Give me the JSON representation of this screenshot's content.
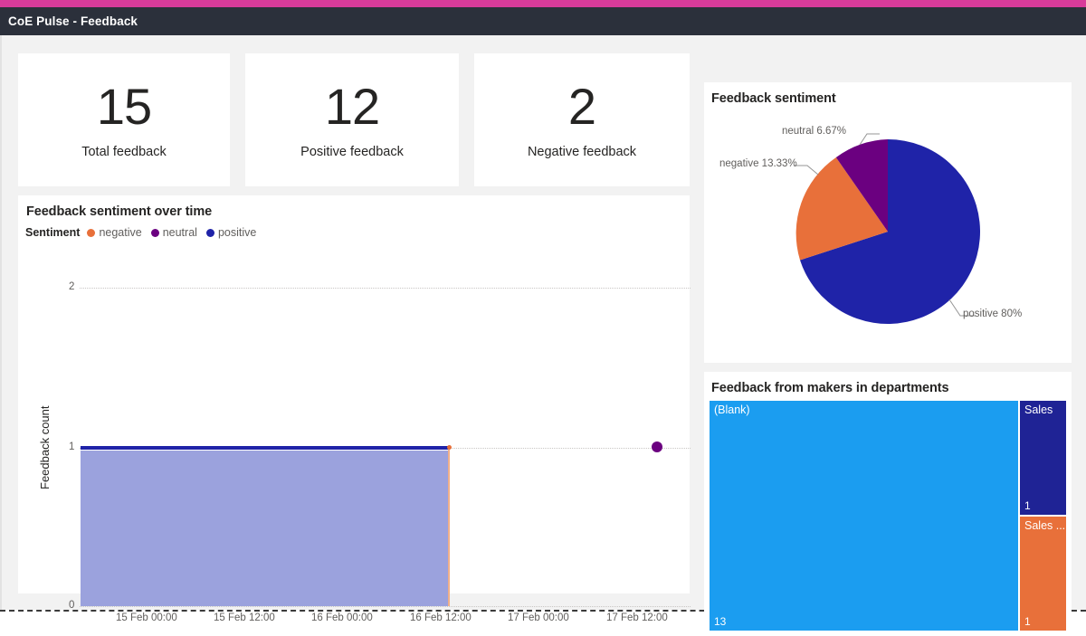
{
  "window": {
    "title": "CoE Pulse - Feedback",
    "accent_color": "#d83b9a",
    "titlebar_color": "#2b303b",
    "canvas_color": "#f2f2f2"
  },
  "kpis": [
    {
      "name": "total-feedback",
      "value": "15",
      "label": "Total feedback"
    },
    {
      "name": "positive-feedback",
      "value": "12",
      "label": "Positive feedback"
    },
    {
      "name": "negative-feedback",
      "value": "2",
      "label": "Negative feedback"
    }
  ],
  "line_visual": {
    "title": "Feedback sentiment over time",
    "legend_caption": "Sentiment",
    "legend": [
      {
        "label": "negative",
        "color": "#e8703a"
      },
      {
        "label": "neutral",
        "color": "#6b0080"
      },
      {
        "label": "positive",
        "color": "#1f23a8"
      }
    ]
  },
  "pie_visual": {
    "title": "Feedback sentiment",
    "labels": [
      {
        "text": "neutral 6.67%",
        "color": "#6b0080"
      },
      {
        "text": "negative 13.33%",
        "color": "#e8703a"
      },
      {
        "text": "positive 80%",
        "color": "#1f23a8"
      }
    ]
  },
  "treemap_visual": {
    "title": "Feedback from makers in departments",
    "nodes": [
      {
        "name": "(Blank)",
        "value": "13",
        "color": "#1b9df0"
      },
      {
        "name": "Sales",
        "value": "1",
        "color": "#1f2395"
      },
      {
        "name": "Sales ...",
        "value": "1",
        "color": "#e8703a"
      }
    ]
  },
  "chart_data": [
    {
      "type": "area",
      "title": "Feedback sentiment over time",
      "xlabel": "",
      "ylabel": "Feedback count",
      "ylim": [
        0,
        2
      ],
      "yticks": [
        "0",
        "1",
        "2"
      ],
      "xticks": [
        "15 Feb 00:00",
        "15 Feb 12:00",
        "16 Feb 00:00",
        "16 Feb 12:00",
        "17 Feb 00:00",
        "17 Feb 12:00"
      ],
      "grid": true,
      "legend_position": "top-left",
      "series": [
        {
          "name": "negative",
          "color": "#e8703a",
          "values": [
            0,
            0,
            0,
            0,
            0,
            0
          ]
        },
        {
          "name": "neutral",
          "color": "#6b0080",
          "values": [
            0,
            0,
            0,
            0,
            0,
            1
          ]
        },
        {
          "name": "positive",
          "color": "#1f23a8",
          "values": [
            1,
            1,
            1,
            1,
            0,
            0
          ]
        }
      ]
    },
    {
      "type": "pie",
      "title": "Feedback sentiment",
      "categories": [
        "positive",
        "negative",
        "neutral"
      ],
      "values": [
        80,
        13.33,
        6.67
      ],
      "value_labels": [
        "positive 80%",
        "negative 13.33%",
        "neutral 6.67%"
      ],
      "colors": [
        "#1f23a8",
        "#e8703a",
        "#6b0080"
      ],
      "legend_position": "none"
    },
    {
      "type": "treemap",
      "title": "Feedback from makers in departments",
      "categories": [
        "(Blank)",
        "Sales",
        "Sales ..."
      ],
      "values": [
        13,
        1,
        1
      ],
      "colors": [
        "#1b9df0",
        "#1f2395",
        "#e8703a"
      ]
    }
  ]
}
